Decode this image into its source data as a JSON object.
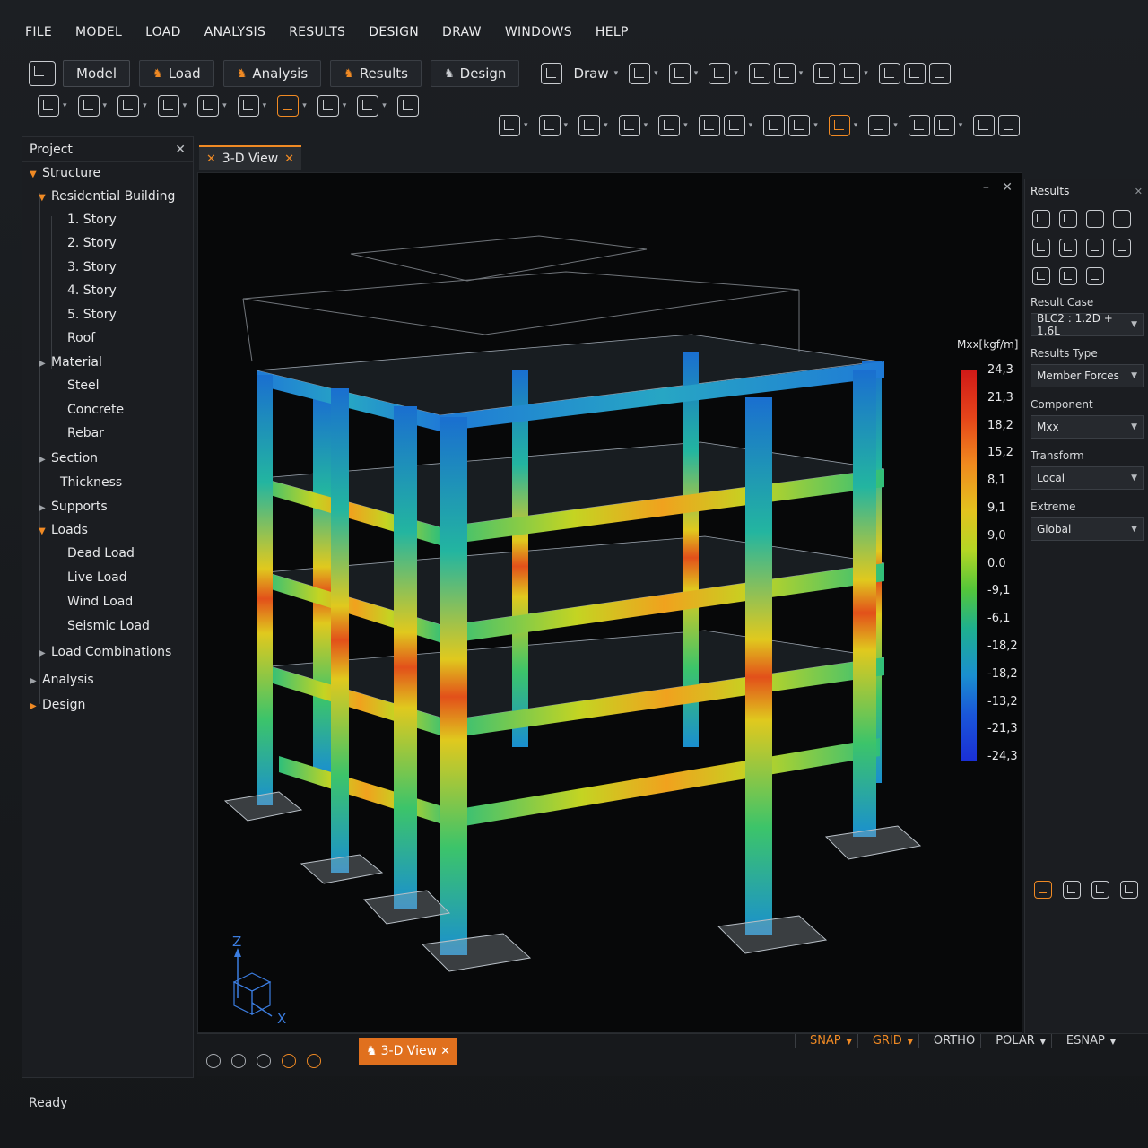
{
  "menu": [
    "FILE",
    "MODEL",
    "LOAD",
    "ANALYSIS",
    "RESULTS",
    "DESIGN",
    "DRAW",
    "WINDOWS",
    "HELP"
  ],
  "modules": {
    "model": "Model",
    "load": "Load",
    "analysis": "Analysis",
    "results": "Results",
    "design": "Design",
    "draw": "Draw"
  },
  "project": {
    "title": "Project",
    "structure": "Structure",
    "building": "Residential Building",
    "stories": [
      "1. Story",
      "2. Story",
      "3. Story",
      "4. Story",
      "5. Story",
      "Roof"
    ],
    "material": "Material",
    "materials": [
      "Steel",
      "Concrete",
      "Rebar"
    ],
    "section": "Section",
    "thickness": "Thickness",
    "supports": "Supports",
    "loads": "Loads",
    "load_items": [
      "Dead Load",
      "Live Load",
      "Wind Load",
      "Seismic Load"
    ],
    "load_combinations": "Load Combinations",
    "analysis": "Analysis",
    "design": "Design"
  },
  "view_tab": "3-D View",
  "legend": {
    "title": "Mxx[kgf/m]",
    "labels": [
      "24,3",
      "21,3",
      "18,2",
      "15,2",
      "8,1",
      "9,1",
      "9,0",
      "0.0",
      "-9,1",
      "-6,1",
      "-18,2",
      "-18,2",
      "-13,2",
      "-21,3",
      "-24,3"
    ]
  },
  "axes": {
    "z": "Z",
    "x": "X"
  },
  "results_panel": {
    "title": "Results",
    "result_case_label": "Result Case",
    "result_case": "BLC2 : 1.2D + 1.6L",
    "results_type_label": "Results Type",
    "results_type": "Member Forces",
    "component_label": "Component",
    "component": "Mxx",
    "transform_label": "Transform",
    "transform": "Local",
    "extreme_label": "Extreme",
    "extreme": "Global"
  },
  "bottom_tab": "3-D View",
  "snaps": [
    {
      "label": "SNAP",
      "active": true
    },
    {
      "label": "GRID",
      "active": true
    },
    {
      "label": "ORTHO",
      "active": false
    },
    {
      "label": "POLAR",
      "active": false
    },
    {
      "label": "ESNAP",
      "active": false
    }
  ],
  "status": "Ready",
  "colors": {
    "accent": "#f08a24",
    "panel": "#1b1d21",
    "viewport": "#070809"
  }
}
